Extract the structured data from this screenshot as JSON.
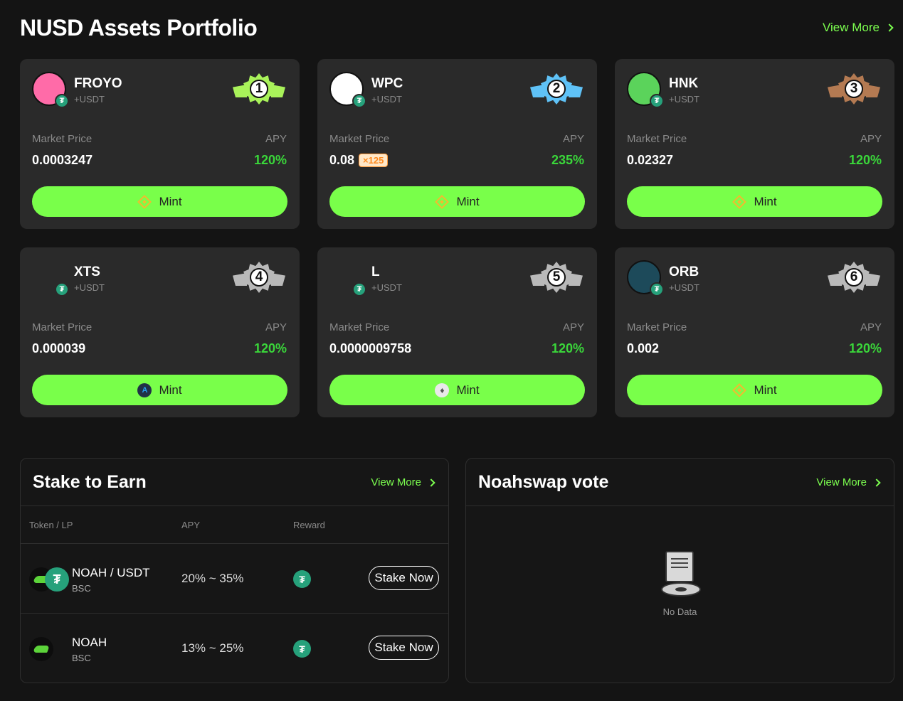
{
  "header": {
    "title": "NUSD Assets Portfolio",
    "view_more": "View More"
  },
  "cards": [
    {
      "name": "FROYO",
      "pair": "+USDT",
      "rank": "1",
      "rank_color": "#a9f25a",
      "icon_bg": "#ff6ba8",
      "market_label": "Market Price",
      "apy_label": "APY",
      "price": "0.0003247",
      "multiplier": "",
      "apy": "120%",
      "mint": "Mint",
      "chain_icon": "bnb-icon"
    },
    {
      "name": "WPC",
      "pair": "+USDT",
      "rank": "2",
      "rank_color": "#5fc2f7",
      "icon_bg": "#ffffff",
      "market_label": "Market Price",
      "apy_label": "APY",
      "price": "0.08",
      "multiplier": "×125",
      "apy": "235%",
      "mint": "Mint",
      "chain_icon": "bnb-icon"
    },
    {
      "name": "HNK",
      "pair": "+USDT",
      "rank": "3",
      "rank_color": "#b47a52",
      "icon_bg": "#5bd35b",
      "market_label": "Market Price",
      "apy_label": "APY",
      "price": "0.02327",
      "multiplier": "",
      "apy": "120%",
      "mint": "Mint",
      "chain_icon": "bnb-icon"
    },
    {
      "name": "XTS",
      "pair": "+USDT",
      "rank": "4",
      "rank_color": "#b9b9b9",
      "icon_bg": "",
      "market_label": "Market Price",
      "apy_label": "APY",
      "price": "0.000039",
      "multiplier": "",
      "apy": "120%",
      "mint": "Mint",
      "chain_icon": "arbitrum-icon"
    },
    {
      "name": "L",
      "pair": "+USDT",
      "rank": "5",
      "rank_color": "#b9b9b9",
      "icon_bg": "",
      "market_label": "Market Price",
      "apy_label": "APY",
      "price": "0.0000009758",
      "multiplier": "",
      "apy": "120%",
      "mint": "Mint",
      "chain_icon": "ethereum-icon"
    },
    {
      "name": "ORB",
      "pair": "+USDT",
      "rank": "6",
      "rank_color": "#b9b9b9",
      "icon_bg": "#1d4a5a",
      "market_label": "Market Price",
      "apy_label": "APY",
      "price": "0.002",
      "multiplier": "",
      "apy": "120%",
      "mint": "Mint",
      "chain_icon": "bnb-icon"
    }
  ],
  "stake": {
    "title": "Stake to Earn",
    "view_more": "View More",
    "columns": [
      "Token / LP",
      "APY",
      "Reward"
    ],
    "rows": [
      {
        "name": "NOAH / USDT",
        "chain": "BSC",
        "apy": "20% ~ 35%",
        "button": "Stake Now",
        "lp": true
      },
      {
        "name": "NOAH",
        "chain": "BSC",
        "apy": "13% ~ 25%",
        "button": "Stake Now",
        "lp": false
      }
    ]
  },
  "vote": {
    "title": "Noahswap vote",
    "view_more": "View More",
    "empty": "No Data"
  },
  "colors": {
    "accent": "#79ff4a",
    "apy_green": "#3ad63a",
    "usdt": "#26a17b",
    "card_bg": "#2a2a2a"
  }
}
